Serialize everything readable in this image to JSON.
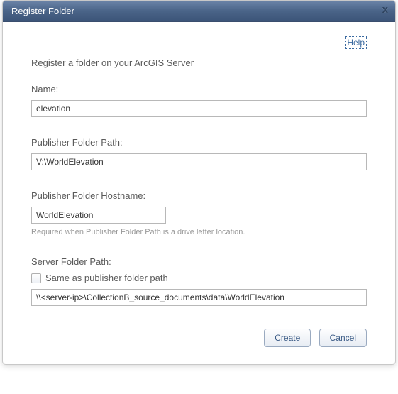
{
  "titlebar": {
    "title": "Register Folder"
  },
  "help": {
    "label": "Help"
  },
  "description": "Register a folder on your ArcGIS Server",
  "name": {
    "label": "Name:",
    "value": "elevation"
  },
  "publisher_path": {
    "label": "Publisher Folder Path:",
    "value": "V:\\WorldElevation"
  },
  "publisher_hostname": {
    "label": "Publisher Folder Hostname:",
    "value": "WorldElevation",
    "hint": "Required when Publisher Folder Path is a drive letter location."
  },
  "server_path": {
    "label": "Server Folder Path:",
    "checkbox_label": "Same as publisher folder path",
    "value": "\\\\<server-ip>\\CollectionB_source_documents\\data\\WorldElevation"
  },
  "buttons": {
    "create": "Create",
    "cancel": "Cancel"
  }
}
